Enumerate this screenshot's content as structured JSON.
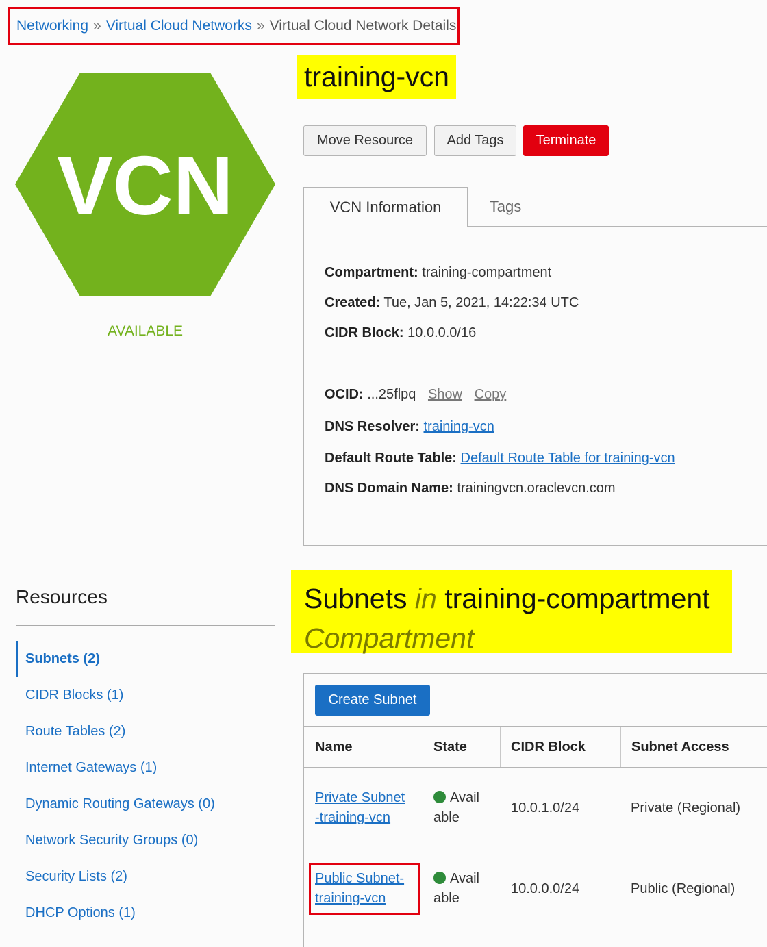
{
  "breadcrumb": {
    "items": [
      "Networking",
      "Virtual Cloud Networks",
      "Virtual Cloud Network Details"
    ],
    "separator": "»"
  },
  "badge": {
    "text": "VCN",
    "state": "AVAILABLE",
    "color": "#73b21d"
  },
  "title": "training-vcn",
  "actions": {
    "move": "Move Resource",
    "add_tags": "Add Tags",
    "terminate": "Terminate"
  },
  "tabs": {
    "info": "VCN Information",
    "tags": "Tags"
  },
  "info": {
    "compartment": {
      "label": "Compartment:",
      "value": "training-compartment"
    },
    "created": {
      "label": "Created:",
      "value": "Tue, Jan 5, 2021, 14:22:34 UTC"
    },
    "cidr": {
      "label": "CIDR Block:",
      "value": "10.0.0.0/16"
    },
    "ocid": {
      "label": "OCID:",
      "value": "...25flpq",
      "show": "Show",
      "copy": "Copy"
    },
    "dns_resolver": {
      "label": "DNS Resolver:",
      "value": "training-vcn"
    },
    "route_table": {
      "label": "Default Route Table:",
      "value": "Default Route Table for training-vcn"
    },
    "dns_domain": {
      "label": "DNS Domain Name:",
      "value": "trainingvcn.oraclevcn.com"
    }
  },
  "resources": {
    "heading": "Resources",
    "items": [
      "Subnets (2)",
      "CIDR Blocks (1)",
      "Route Tables (2)",
      "Internet Gateways (1)",
      "Dynamic Routing Gateways (0)",
      "Network Security Groups (0)",
      "Security Lists (2)",
      "DHCP Options (1)"
    ]
  },
  "subnets": {
    "heading_pre": "Subnets",
    "heading_in": "in",
    "heading_name": "training-compartment",
    "heading_post": "Compartment",
    "create_label": "Create Subnet",
    "columns": [
      "Name",
      "State",
      "CIDR Block",
      "Subnet Access"
    ],
    "rows": [
      {
        "name_1": "Private Subnet",
        "name_2": "-training-vcn",
        "state_1": "Avail",
        "state_2": "able",
        "cidr": "10.0.1.0/24",
        "access": "Private (Regional)"
      },
      {
        "name_1": "Public Subnet-",
        "name_2": "training-vcn",
        "state_1": "Avail",
        "state_2": "able",
        "cidr": "10.0.0.0/24",
        "access": "Public (Regional)"
      }
    ]
  }
}
